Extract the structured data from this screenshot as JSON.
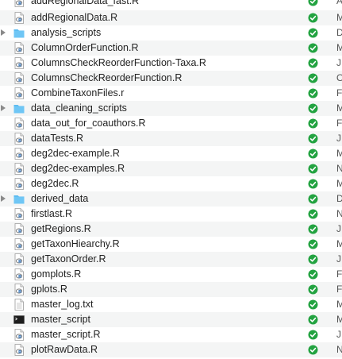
{
  "colors": {
    "status_green": "#23a341",
    "folder_blue": "#5cbcf1",
    "row_alt": "#f4f5f5"
  },
  "files": [
    {
      "name": "addRegionalData_fast.R",
      "type": "r-file",
      "status": "synced",
      "kind": "A"
    },
    {
      "name": "addRegionalData.R",
      "type": "r-file",
      "status": "synced",
      "kind": "M"
    },
    {
      "name": "analysis_scripts",
      "type": "folder",
      "status": "synced",
      "kind": "D"
    },
    {
      "name": "ColumnOrderFunction.R",
      "type": "r-file",
      "status": "synced",
      "kind": "M"
    },
    {
      "name": "ColumnsCheckReorderFunction-Taxa.R",
      "type": "r-file",
      "status": "synced",
      "kind": "J"
    },
    {
      "name": "ColumnsCheckReorderFunction.R",
      "type": "r-file",
      "status": "synced",
      "kind": "O"
    },
    {
      "name": "CombineTaxonFiles.r",
      "type": "r-file",
      "status": "synced",
      "kind": "F"
    },
    {
      "name": "data_cleaning_scripts",
      "type": "folder",
      "status": "synced",
      "kind": "M"
    },
    {
      "name": "data_out_for_coauthors.R",
      "type": "r-file",
      "status": "synced",
      "kind": "F"
    },
    {
      "name": "dataTests.R",
      "type": "r-file",
      "status": "synced",
      "kind": "J"
    },
    {
      "name": "deg2dec-example.R",
      "type": "r-file",
      "status": "synced",
      "kind": "M"
    },
    {
      "name": "deg2dec-examples.R",
      "type": "r-file",
      "status": "synced",
      "kind": "N"
    },
    {
      "name": "deg2dec.R",
      "type": "r-file",
      "status": "synced",
      "kind": "M"
    },
    {
      "name": "derived_data",
      "type": "folder",
      "status": "synced",
      "kind": "D"
    },
    {
      "name": "firstlast.R",
      "type": "r-file",
      "status": "synced",
      "kind": "N"
    },
    {
      "name": "getRegions.R",
      "type": "r-file",
      "status": "synced",
      "kind": "J"
    },
    {
      "name": "getTaxonHiearchy.R",
      "type": "r-file",
      "status": "synced",
      "kind": "M"
    },
    {
      "name": "getTaxonOrder.R",
      "type": "r-file",
      "status": "synced",
      "kind": "J"
    },
    {
      "name": "gomplots.R",
      "type": "r-file",
      "status": "synced",
      "kind": "F"
    },
    {
      "name": "gplots.R",
      "type": "r-file",
      "status": "synced",
      "kind": "F"
    },
    {
      "name": "master_log.txt",
      "type": "text-file",
      "status": "synced",
      "kind": "M"
    },
    {
      "name": "master_script",
      "type": "terminal-file",
      "status": "synced",
      "kind": "M"
    },
    {
      "name": "master_script.R",
      "type": "r-file",
      "status": "synced",
      "kind": "J"
    },
    {
      "name": "plotRawData.R",
      "type": "r-file",
      "status": "synced",
      "kind": "N"
    }
  ]
}
